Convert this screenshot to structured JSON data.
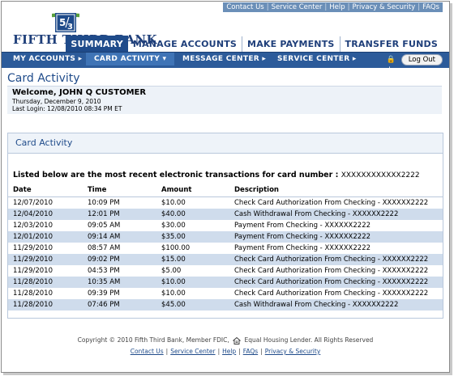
{
  "util_links": [
    "Contact Us",
    "Service Center",
    "Help",
    "Privacy & Security",
    "FAQs"
  ],
  "brand": "FIFTH THIRD BANK",
  "main_tabs": [
    "SUMMARY",
    "MANAGE ACCOUNTS",
    "MAKE PAYMENTS",
    "TRANSFER FUNDS"
  ],
  "nav": {
    "items": [
      "MY ACCOUNTS ▸",
      "CARD ACTIVITY ▾",
      "MESSAGE CENTER ▸",
      "SERVICE CENTER ▸"
    ],
    "lock_symbol": "🔒+",
    "logout": "Log Out"
  },
  "page_title": "Card Activity",
  "welcome": {
    "name": "Welcome, JOHN Q CUSTOMER",
    "date": "Thursday, December 9, 2010",
    "last_login": "Last Login: 12/08/2010 08:34 PM ET"
  },
  "card": {
    "heading": "Card Activity",
    "listed_text": "Listed below are the most recent electronic transactions for card number : ",
    "card_number": "XXXXXXXXXXXX2222",
    "columns": [
      "Date",
      "Time",
      "Amount",
      "Description"
    ],
    "rows": [
      [
        "12/07/2010",
        "10:09 PM",
        "$10.00",
        "Check Card Authorization From Checking - XXXXXX2222"
      ],
      [
        "12/04/2010",
        "12:01 PM",
        "$40.00",
        "Cash Withdrawal From Checking - XXXXXX2222"
      ],
      [
        "12/03/2010",
        "09:05 AM",
        "$30.00",
        "Payment From Checking - XXXXXX2222"
      ],
      [
        "12/01/2010",
        "09:14 AM",
        "$35.00",
        "Payment From Checking - XXXXXX2222"
      ],
      [
        "11/29/2010",
        "08:57 AM",
        "$100.00",
        "Payment From Checking - XXXXXX2222"
      ],
      [
        "11/29/2010",
        "09:02 PM",
        "$15.00",
        "Check Card Authorization From Checking - XXXXXX2222"
      ],
      [
        "11/29/2010",
        "04:53 PM",
        "$5.00",
        "Check Card Authorization From Checking - XXXXXX2222"
      ],
      [
        "11/28/2010",
        "10:35 AM",
        "$10.00",
        "Check Card Authorization From Checking - XXXXXX2222"
      ],
      [
        "11/28/2010",
        "09:39 PM",
        "$10.00",
        "Check Card Authorization From Checking - XXXXXX2222"
      ],
      [
        "11/28/2010",
        "07:46 PM",
        "$45.00",
        "Cash Withdrawal From Checking - XXXXXX2222"
      ]
    ]
  },
  "footer": {
    "copyright": "Copyright © 2010 Fifth Third Bank, Member FDIC,",
    "equal_housing": "Equal Housing Lender. All Rights Reserved",
    "links": [
      "Contact Us",
      "Service Center",
      "Help",
      "FAQs",
      "Privacy & Security"
    ]
  },
  "colors": {
    "brand_blue": "#1f4b8a",
    "nav_blue": "#2c5b9a",
    "logo_green": "#5aa03c",
    "row_alt": "#cfdcec"
  }
}
